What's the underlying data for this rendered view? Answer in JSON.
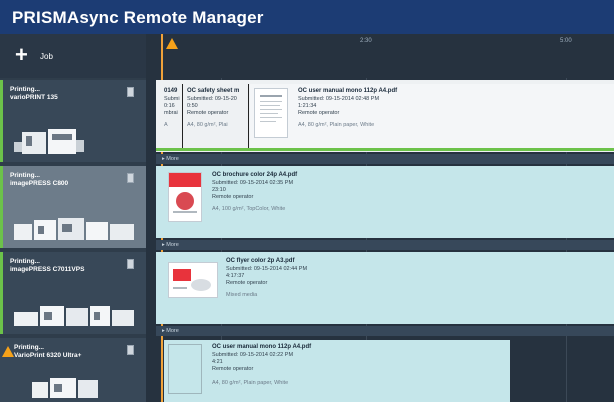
{
  "app": {
    "title": "PRISMAsync Remote Manager"
  },
  "sidebar": {
    "new_job_label": "Job",
    "printers": [
      {
        "status": "Printing...",
        "name": "varioPRINT 135",
        "status_color": "#6cc24a",
        "warning": false
      },
      {
        "status": "Printing...",
        "name": "imagePRESS C800",
        "status_color": "#6cc24a",
        "warning": false
      },
      {
        "status": "Printing...",
        "name": "imagePRESS C7011VPS",
        "status_color": "#6cc24a",
        "warning": false
      },
      {
        "status": "Printing...",
        "name": "VarioPrint 6320 Ultra+",
        "status_color": "#f6a21a",
        "warning": true
      }
    ]
  },
  "timeline": {
    "ticks": [
      "2:30",
      "5:00"
    ],
    "more_label": "More",
    "rows": [
      {
        "jobs": [
          {
            "name": "0149",
            "lines": [
              "Submi",
              "0:16",
              "mbrai"
            ],
            "media": "A"
          },
          {
            "name": "OC safety sheet m",
            "lines": [
              "Submitted: 09-15-20",
              "0:50",
              "Remote operator"
            ],
            "media": "A4, 80 g/m², Plai"
          },
          {
            "name": "OC user manual mono 112p A4.pdf",
            "lines": [
              "Submitted: 09-15-2014 02:48 PM",
              "1:21:34",
              "Remote operator"
            ],
            "media": "A4, 80 g/m², Plain paper, White"
          }
        ]
      },
      {
        "jobs": [
          {
            "name": "OC brochure color 24p A4.pdf",
            "lines": [
              "Submitted: 09-15-2014 02:35 PM",
              "23:10",
              "Remote operator"
            ],
            "media": "A4, 100 g/m², TopColor, White"
          }
        ]
      },
      {
        "jobs": [
          {
            "name": "OC flyer color 2p A3.pdf",
            "lines": [
              "Submitted: 09-15-2014 02:44 PM",
              "4:17:37",
              "Remote operator"
            ],
            "media": "Mixed media"
          }
        ]
      },
      {
        "jobs": [
          {
            "name": "OC user manual mono 112p A4.pdf",
            "lines": [
              "Submitted: 09-15-2014 02:22 PM",
              "4:21",
              "Remote operator"
            ],
            "media": "A4, 80 g/m², Plain paper, White"
          }
        ]
      }
    ]
  },
  "colors": {
    "titlebar": "#1c3c74",
    "printing_green": "#6cc24a",
    "warning_orange": "#f6a21a",
    "job_teal": "#c5e6ea"
  },
  "icons": [
    "plus-icon",
    "warning-icon",
    "document-icon",
    "media-icon",
    "chevron-right-icon"
  ]
}
